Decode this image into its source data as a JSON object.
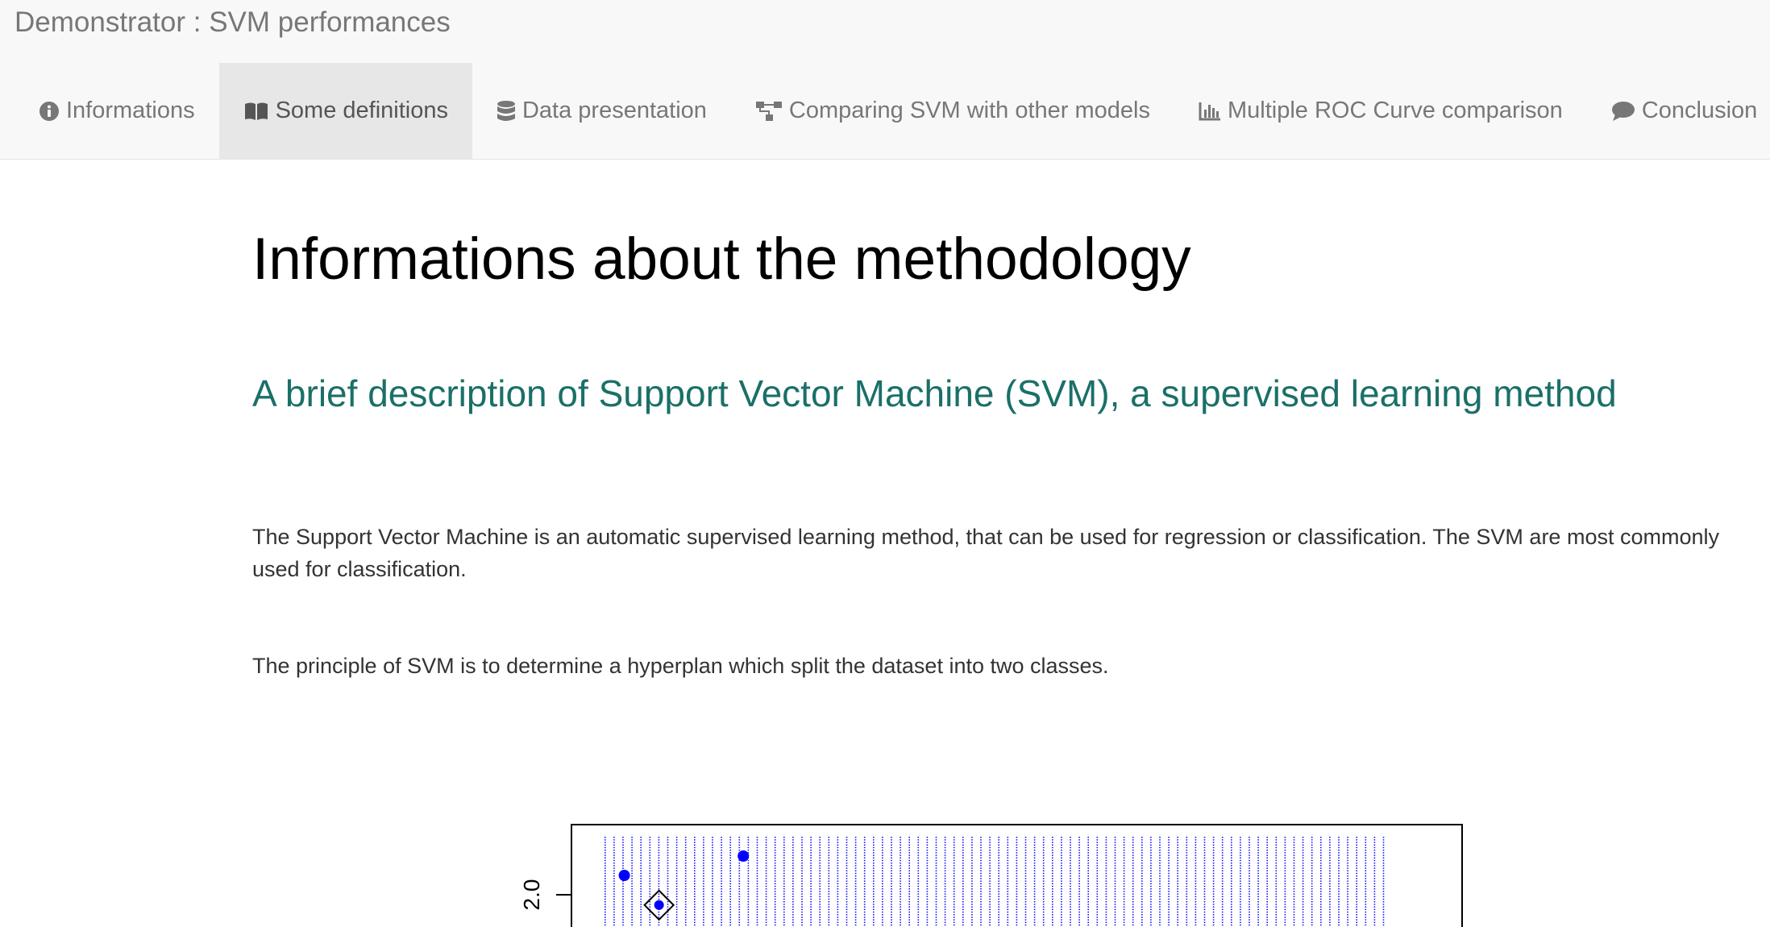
{
  "app": {
    "title": "Demonstrator : SVM performances"
  },
  "nav": {
    "tabs": [
      {
        "label": "Informations",
        "icon": "info-circle-icon",
        "active": false
      },
      {
        "label": "Some definitions",
        "icon": "open-book-icon",
        "active": true
      },
      {
        "label": "Data presentation",
        "icon": "database-icon",
        "active": false
      },
      {
        "label": "Comparing SVM with other models",
        "icon": "sitemap-icon",
        "active": false
      },
      {
        "label": "Multiple ROC Curve comparison",
        "icon": "bar-chart-icon",
        "active": false
      },
      {
        "label": "Conclusion",
        "icon": "comment-icon",
        "active": false
      }
    ]
  },
  "main": {
    "title": "Informations about the methodology",
    "subtitle": "A brief description of Support Vector Machine (SVM), a supervised learning method",
    "paragraphs": [
      "The Support Vector Machine is an automatic supervised learning method, that can be used for regression or classification. The SVM are most commonly used for classification.",
      "The principle of SVM is to determine a hyperplan which split the dataset into two classes."
    ]
  },
  "colors": {
    "subtitle": "#1a7068",
    "navbar_bg": "#f8f8f8",
    "active_tab_bg": "#e7e7e7",
    "plot_points": "#0000ff"
  },
  "chart_data": {
    "type": "scatter",
    "title": "",
    "xlabel": "",
    "ylabel": "",
    "y_tick_labels": [
      "2.0"
    ],
    "points": [
      {
        "x": 0.04,
        "y": 2.15,
        "class": "blue",
        "support_vector": false
      },
      {
        "x": 0.28,
        "y": 2.3,
        "class": "blue",
        "support_vector": false
      },
      {
        "x": 0.11,
        "y": 1.92,
        "class": "blue",
        "support_vector": true
      }
    ]
  }
}
